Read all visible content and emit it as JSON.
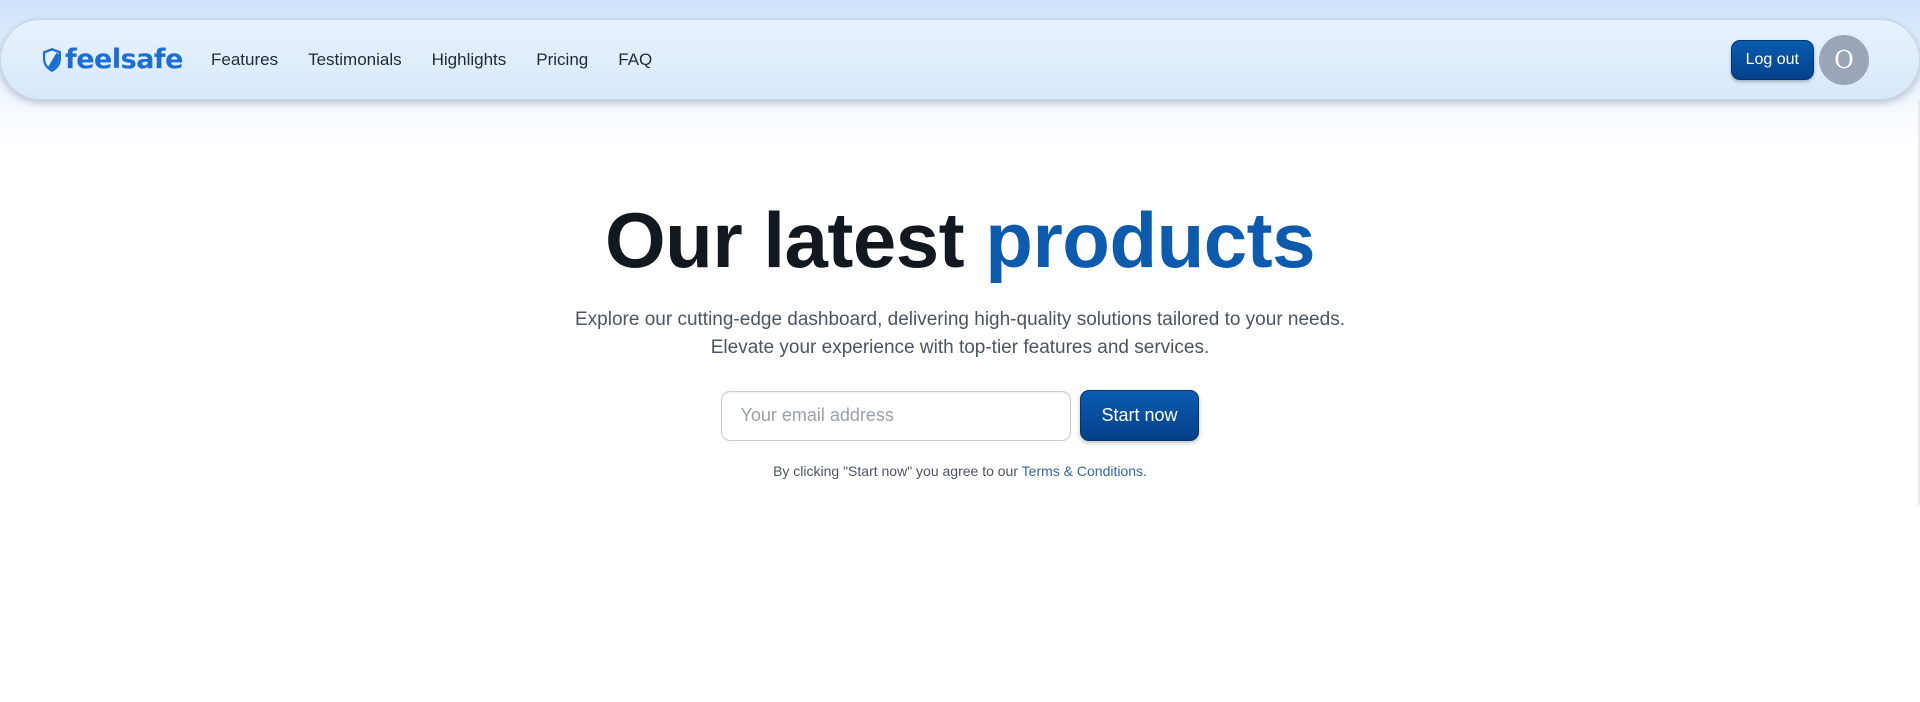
{
  "navbar": {
    "brand_icon": "shield-icon",
    "brand_name": "feelsafe",
    "links": [
      "Features",
      "Testimonials",
      "Highlights",
      "Pricing",
      "FAQ"
    ],
    "logout_label": "Log out",
    "avatar_initial": "O"
  },
  "hero": {
    "title_main": "Our latest ",
    "title_accent": "products",
    "subtitle_line1": "Explore our cutting-edge dashboard, delivering high-quality solutions tailored to your needs.",
    "subtitle_line2": "Elevate your experience with top-tier features and services.",
    "email_placeholder": "Your email address",
    "email_value": "",
    "cta_label": "Start now",
    "terms_prefix": "By clicking \"Start now\" you agree to our ",
    "terms_link": "Terms & Conditions",
    "terms_suffix": "."
  },
  "colors": {
    "brand": "#1a6fd6",
    "accent": "#0d5bae",
    "primary_button": "#04418a",
    "avatar_bg": "#9aa6b8"
  }
}
